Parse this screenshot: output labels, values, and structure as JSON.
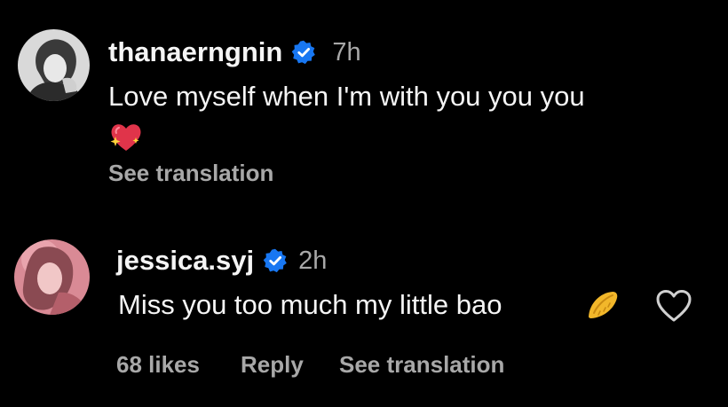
{
  "comments": [
    {
      "username": "thanaerngnin",
      "verified": true,
      "time": "7h",
      "text": "Love myself when I'm with you you you",
      "emoji": "sparkling-heart",
      "actions": {
        "see_translation": "See translation"
      }
    },
    {
      "username": "jessica.syj",
      "verified": true,
      "time": "2h",
      "text": "Miss you too much my little bao",
      "emoji": "dumpling",
      "actions": {
        "likes": "68 likes",
        "reply": "Reply",
        "see_translation": "See translation"
      }
    }
  ],
  "colors": {
    "background": "#000000",
    "text_primary": "#f5f5f5",
    "text_secondary": "#a8a8a8",
    "verified_blue": "#1877f2"
  },
  "icons": [
    "verified-badge-icon",
    "sparkling-heart-emoji",
    "dumpling-emoji",
    "heart-outline-icon"
  ]
}
